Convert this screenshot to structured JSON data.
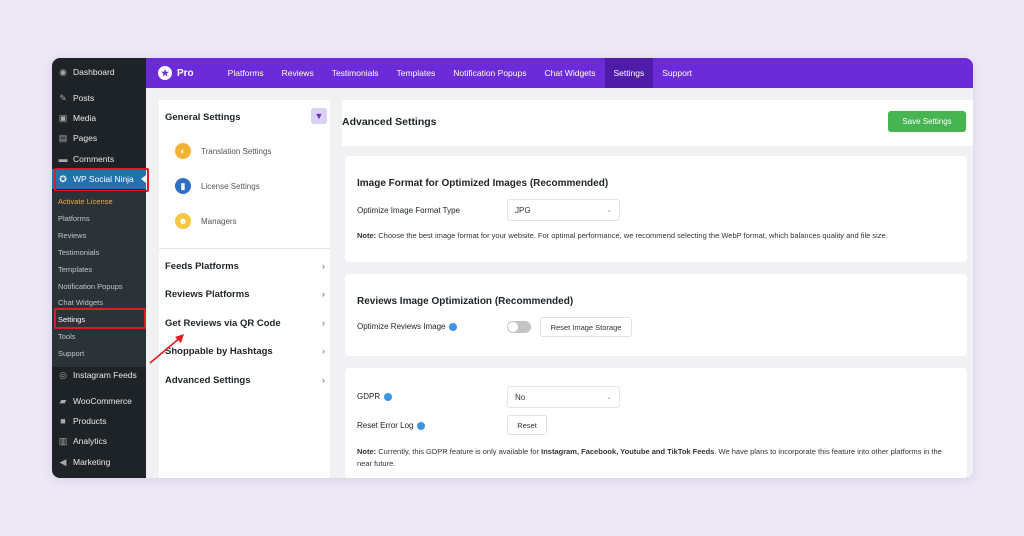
{
  "wp_menu": {
    "dashboard": "Dashboard",
    "posts": "Posts",
    "media": "Media",
    "pages": "Pages",
    "comments": "Comments",
    "wp_social_ninja": "WP Social Ninja",
    "submenu": [
      "Activate License",
      "Platforms",
      "Reviews",
      "Testimonials",
      "Templates",
      "Notification Popups",
      "Chat Widgets",
      "Settings",
      "Tools",
      "Support"
    ],
    "instagram_feeds": "Instagram Feeds",
    "woocommerce": "WooCommerce",
    "products": "Products",
    "analytics": "Analytics",
    "marketing": "Marketing"
  },
  "topbar": {
    "logo": "Pro",
    "tabs": [
      "Platforms",
      "Reviews",
      "Testimonials",
      "Templates",
      "Notification Popups",
      "Chat Widgets",
      "Settings",
      "Support"
    ],
    "active_tab": "Settings"
  },
  "settings_nav": {
    "general": "General Settings",
    "sub_items": [
      "Translation Settings",
      "License Settings",
      "Managers"
    ],
    "sections": [
      "Feeds Platforms",
      "Reviews Platforms",
      "Get Reviews via QR Code",
      "Shoppable by Hashtags",
      "Advanced Settings"
    ]
  },
  "main": {
    "title": "Advanced Settings",
    "save_label": "Save Settings",
    "image_format": {
      "heading": "Image Format for Optimized Images (Recommended)",
      "label": "Optimize Image Format Type",
      "value": "JPG",
      "note_prefix": "Note:",
      "note": "Choose the best image format for your website. For optimal performance, we recommend selecting the WebP format, which balances quality and file size."
    },
    "reviews_image": {
      "heading": "Reviews Image Optimization (Recommended)",
      "label": "Optimize Reviews Image",
      "button": "Reset Image Storage"
    },
    "gdpr": {
      "label": "GDPR",
      "value": "No",
      "reset_label": "Reset Error Log",
      "reset_button": "Reset",
      "note_prefix": "Note:",
      "note_a": "Currently, this GDPR feature is only available for",
      "note_bold": "Instagram, Facebook, Youtube and TikTok Feeds",
      "note_b": ". We have plans to incorporate this feature into other platforms in the near future."
    }
  },
  "colors": {
    "brand": "#6c2bd9",
    "wp_sidebar": "#1e2327",
    "highlight": "#e01b24",
    "save": "#46b450"
  }
}
